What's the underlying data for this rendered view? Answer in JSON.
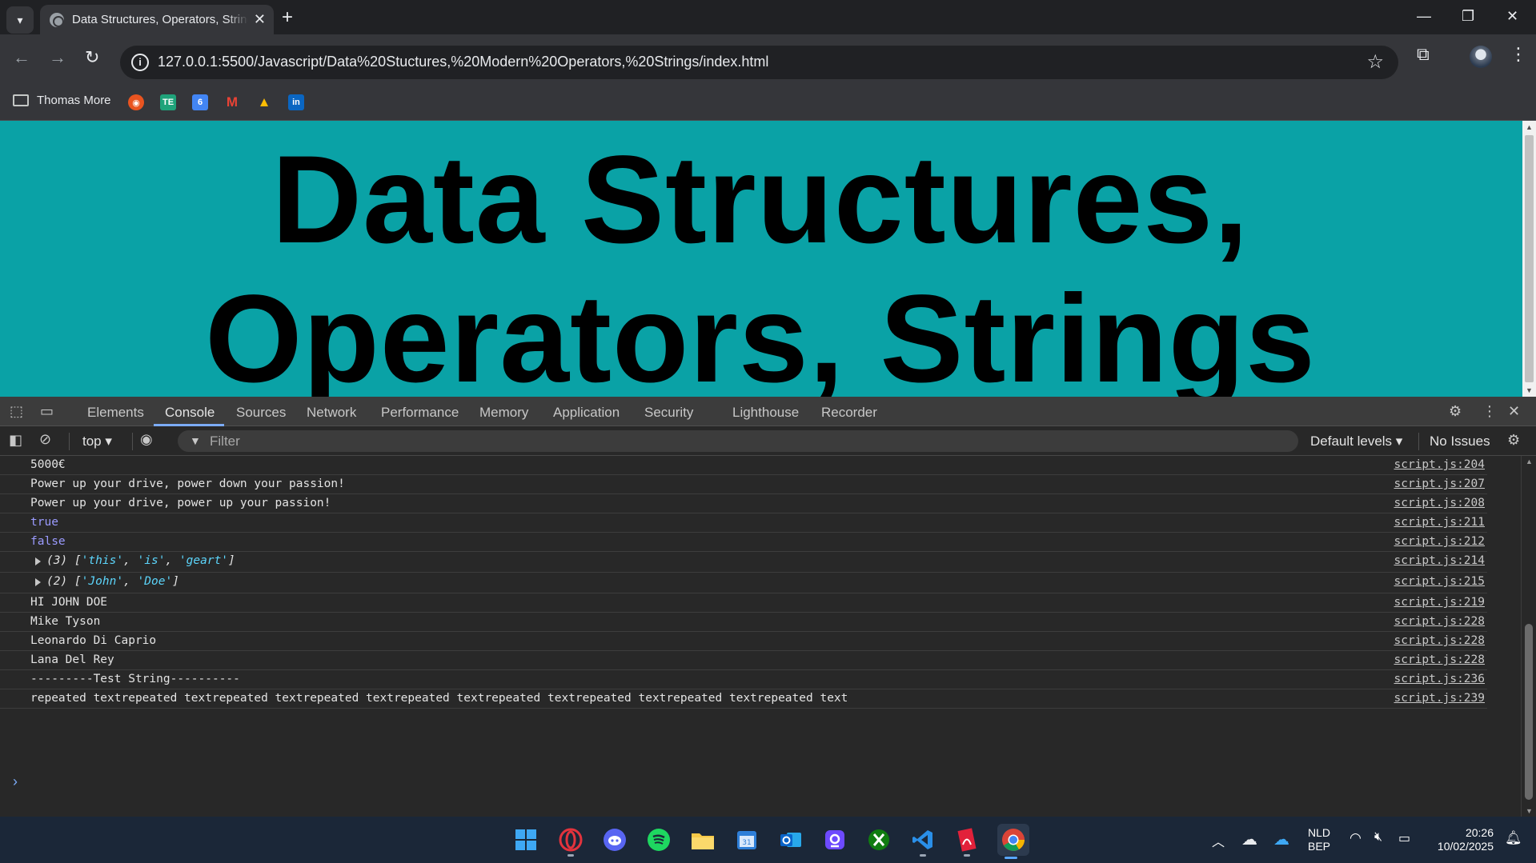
{
  "browser": {
    "tab_title": "Data Structures, Operators, Strings",
    "url": "127.0.0.1:5500/Javascript/Data%20Stuctures,%20Modern%20Operators,%20Strings/index.html",
    "bookmarks": {
      "folder_label": "Thomas More",
      "items": [
        {
          "name": "ubuntu",
          "color": "#e95420",
          "glyph": "◉"
        },
        {
          "name": "te",
          "color": "#1fa37a",
          "glyph": "TE"
        },
        {
          "name": "google-calendar",
          "color": "#4285f4",
          "glyph": "6"
        },
        {
          "name": "gmail",
          "color": "#ea4335",
          "glyph": "M"
        },
        {
          "name": "google-drive",
          "color": "#fbbc04",
          "glyph": "▲"
        },
        {
          "name": "linkedin",
          "color": "#0a66c2",
          "glyph": "in"
        }
      ]
    }
  },
  "page": {
    "heading": "Data Structures, Operators, Strings",
    "background": "#0aa2a6"
  },
  "devtools": {
    "tabs": [
      "Elements",
      "Console",
      "Sources",
      "Network",
      "Performance",
      "Memory",
      "Application",
      "Security",
      "Lighthouse",
      "Recorder"
    ],
    "active_tab": "Console",
    "context": "top",
    "filter_placeholder": "Filter",
    "levels_label": "Default levels",
    "issues_label": "No Issues",
    "console": [
      {
        "kind": "text",
        "text": "5000€",
        "source": "script.js:204"
      },
      {
        "kind": "text",
        "text": "Power up your drive, power down your passion!",
        "source": "script.js:207"
      },
      {
        "kind": "text",
        "text": "Power up your drive, power up your passion!",
        "source": "script.js:208"
      },
      {
        "kind": "bool",
        "text": "true",
        "source": "script.js:211"
      },
      {
        "kind": "bool",
        "text": "false",
        "source": "script.js:212"
      },
      {
        "kind": "array",
        "count": "(3)",
        "items": [
          "'this'",
          "'is'",
          "'geart'"
        ],
        "source": "script.js:214"
      },
      {
        "kind": "array",
        "count": "(2)",
        "items": [
          "'John'",
          "'Doe'"
        ],
        "source": "script.js:215"
      },
      {
        "kind": "text",
        "text": "HI JOHN DOE",
        "source": "script.js:219"
      },
      {
        "kind": "text",
        "text": "Mike Tyson",
        "source": "script.js:228"
      },
      {
        "kind": "text",
        "text": "Leonardo Di Caprio",
        "source": "script.js:228"
      },
      {
        "kind": "text",
        "text": "Lana Del Rey",
        "source": "script.js:228"
      },
      {
        "kind": "text",
        "text": "---------Test String----------",
        "source": "script.js:236"
      },
      {
        "kind": "text",
        "text": "repeated textrepeated textrepeated textrepeated textrepeated textrepeated textrepeated textrepeated textrepeated text",
        "source": "script.js:239"
      }
    ]
  },
  "taskbar": {
    "apps": [
      "windows-start",
      "opera",
      "discord",
      "spotify",
      "file-explorer",
      "calendar",
      "outlook",
      "proton",
      "xbox",
      "vscode",
      "acrobat",
      "chrome"
    ],
    "language_top": "NLD",
    "language_bottom": "BEP",
    "time": "20:26",
    "date": "10/02/2025"
  }
}
